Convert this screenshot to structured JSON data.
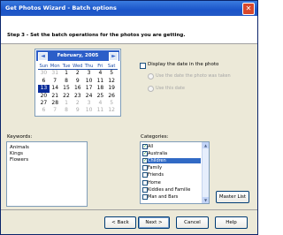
{
  "window": {
    "title": "Get Photos Wizard - Batch options",
    "close_glyph": "✕"
  },
  "step": {
    "text": "Step 3 - Set the batch operations for the photos you are getting."
  },
  "calendar": {
    "month_label": "February, 2005",
    "prev_glyph": "◄",
    "next_glyph": "►",
    "days_of_week": [
      "Sun",
      "Mon",
      "Tue",
      "Wed",
      "Thu",
      "Fri",
      "Sat"
    ],
    "weeks": [
      [
        "30",
        "31",
        "1",
        "2",
        "3",
        "4",
        "5"
      ],
      [
        "6",
        "7",
        "8",
        "9",
        "10",
        "11",
        "12"
      ],
      [
        "13",
        "14",
        "15",
        "16",
        "17",
        "18",
        "19"
      ],
      [
        "20",
        "21",
        "22",
        "23",
        "24",
        "25",
        "26"
      ],
      [
        "27",
        "28",
        "1",
        "2",
        "3",
        "4",
        "5"
      ],
      [
        "6",
        "7",
        "8",
        "9",
        "10",
        "11",
        "12"
      ]
    ],
    "selected_day": "13"
  },
  "display_date": {
    "label": "Display the date in the photo",
    "checked": false,
    "options": [
      "Use the date the photo was taken",
      "Use this date"
    ]
  },
  "keywords": {
    "label": "Keywords:",
    "items": [
      "Animals",
      "Kings",
      "Flowers"
    ]
  },
  "categories": {
    "label": "Categories:",
    "items": [
      {
        "label": "All",
        "checked": true
      },
      {
        "label": "Australia",
        "checked": true
      },
      {
        "label": "Children",
        "checked": true,
        "highlighted": true
      },
      {
        "label": "Family",
        "checked": false
      },
      {
        "label": "Friends",
        "checked": false
      },
      {
        "label": "Home",
        "checked": false
      },
      {
        "label": "Kiddies and Familie",
        "checked": false
      },
      {
        "label": "Man and Bars",
        "checked": false
      }
    ]
  },
  "buttons": {
    "master_list": "Master List",
    "back": "< Back",
    "next": "Next >",
    "cancel": "Cancel",
    "help": "Help"
  },
  "colors": {
    "title_bar": "#1b55c9",
    "selection": "#316ac5",
    "calendar_header": "#2c5ec8"
  }
}
